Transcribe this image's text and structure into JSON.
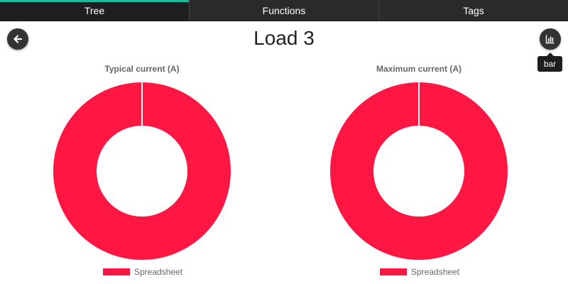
{
  "tabs": [
    {
      "label": "Tree",
      "active": true
    },
    {
      "label": "Functions",
      "active": false
    },
    {
      "label": "Tags",
      "active": false
    }
  ],
  "page": {
    "title": "Load 3",
    "back_icon": "arrow-left-icon",
    "chart_toggle_icon": "bar-chart-icon",
    "tooltip": "bar"
  },
  "colors": {
    "accent": "#1abc9c",
    "series": "#ff1744"
  },
  "chart_data": [
    {
      "type": "pie",
      "variant": "donut",
      "title": "Typical current (A)",
      "labels": [
        "Spreadsheet"
      ],
      "values": [
        1
      ],
      "legend": "bottom"
    },
    {
      "type": "pie",
      "variant": "donut",
      "title": "Maximum current (A)",
      "labels": [
        "Spreadsheet"
      ],
      "values": [
        1
      ],
      "legend": "bottom"
    }
  ]
}
